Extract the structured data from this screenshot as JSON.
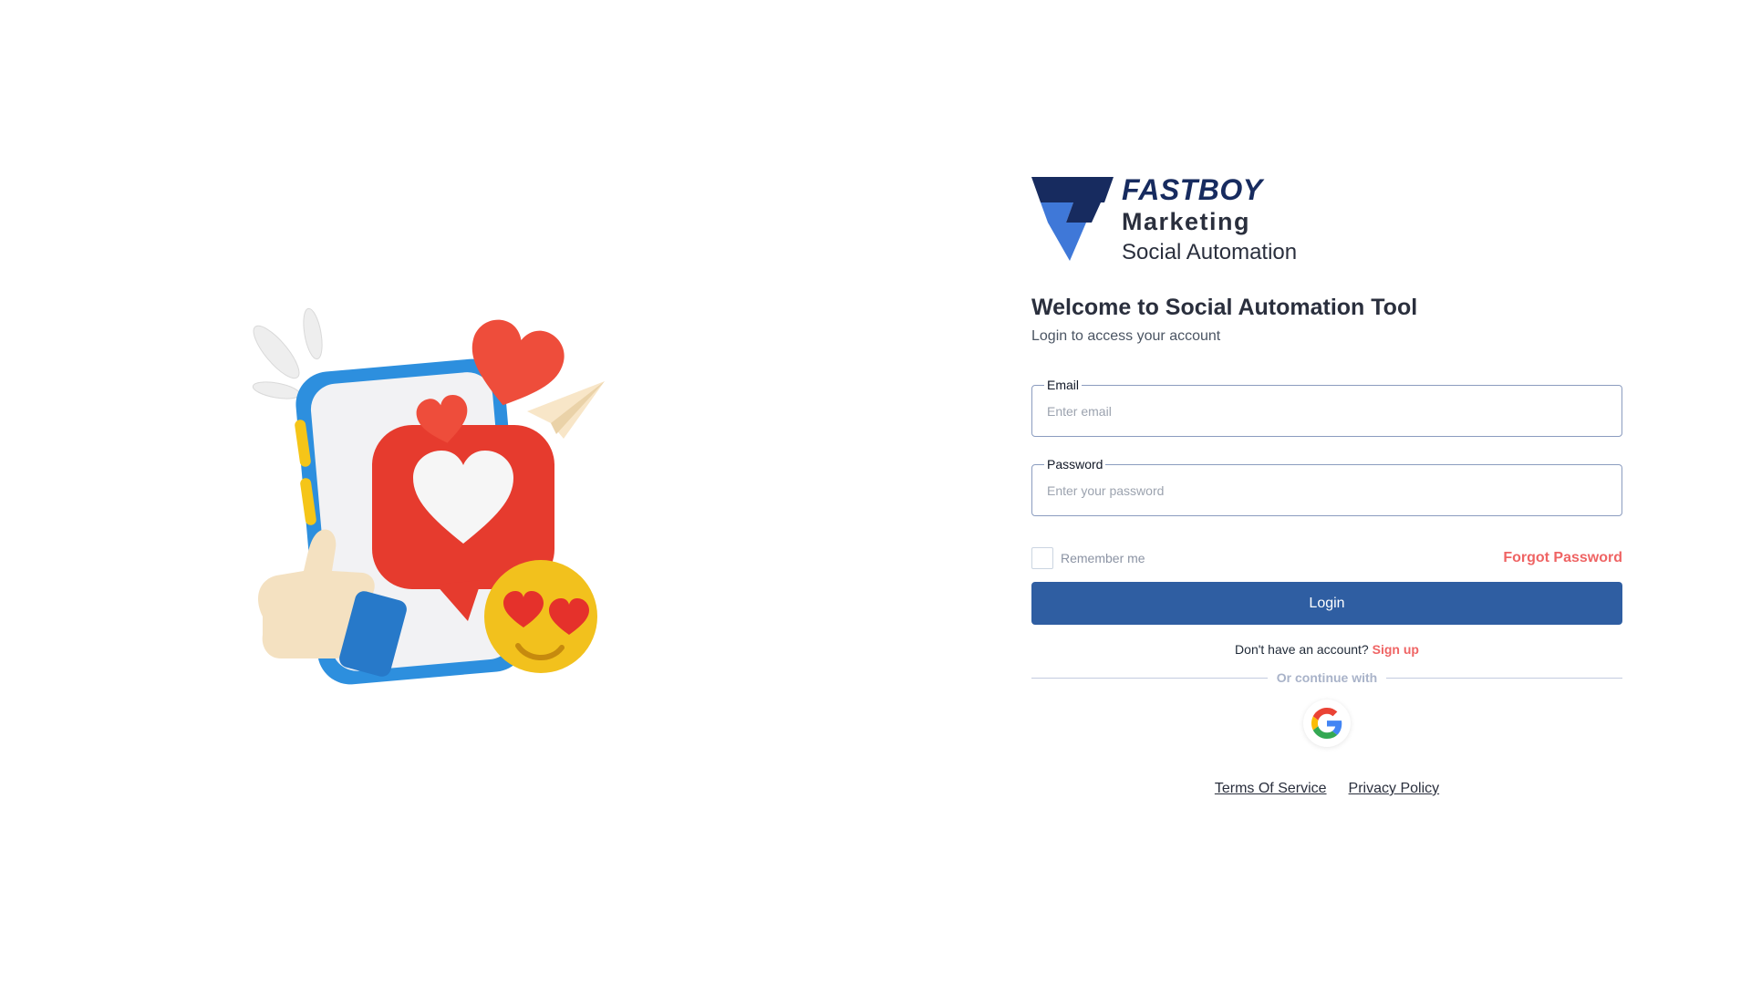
{
  "brand": {
    "name": "FASTBOY",
    "subtitle": "Marketing",
    "tagline": "Social Automation",
    "colors": {
      "dark": "#172b5f",
      "light": "#3f78d8"
    }
  },
  "welcome": {
    "title": "Welcome to Social Automation Tool",
    "subtitle": "Login to access your account"
  },
  "form": {
    "email": {
      "label": "Email",
      "placeholder": "Enter email",
      "value": ""
    },
    "password": {
      "label": "Password",
      "placeholder": "Enter your password",
      "value": ""
    },
    "remember_label": "Remember me",
    "remember_checked": false,
    "forgot_label": "Forgot Password",
    "login_label": "Login"
  },
  "signup": {
    "prompt": "Don't have an account?",
    "link_label": "Sign up"
  },
  "divider_text": "Or continue with",
  "social": {
    "icon": "google-icon"
  },
  "footer": {
    "terms_label": "Terms Of Service",
    "privacy_label": "Privacy Policy"
  },
  "illustration": {
    "icons": [
      "smartphone-icon",
      "heart-speech-bubble-icon",
      "heart-icon",
      "paper-plane-icon",
      "thumbs-up-icon",
      "heart-eyes-emoji-icon",
      "sparkle-icon"
    ]
  },
  "colors": {
    "primary": "#2f5ea2",
    "accent": "#ef6464",
    "border": "#8b9cbf"
  }
}
